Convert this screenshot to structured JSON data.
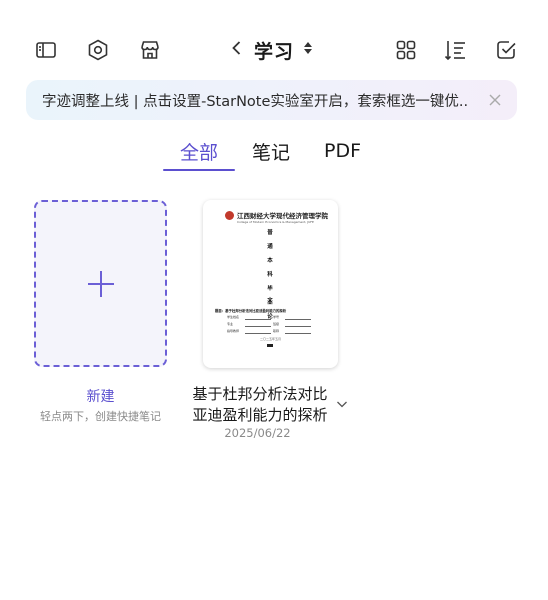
{
  "toolbar": {
    "title": "学习",
    "icons": [
      "sidebar-icon",
      "settings-hexagon-icon",
      "store-icon",
      "back-chevron-icon",
      "sort-updown-icon",
      "grid-view-icon",
      "sort-list-icon",
      "select-check-icon"
    ]
  },
  "banner": {
    "text": "字迹调整上线 | 点击设置-StarNote实验室开启，套索框选一键优.."
  },
  "tabs": [
    {
      "label": "全部",
      "active": true
    },
    {
      "label": "笔记",
      "active": false
    },
    {
      "label": "PDF",
      "active": false
    }
  ],
  "new_note": {
    "label": "新建",
    "hint": "轻点两下，创建快捷笔记"
  },
  "documents": [
    {
      "name_line1": "基于杜邦分析法对比",
      "name_line2": "亚迪盈利能力的探析",
      "date": "2025/06/22",
      "thumbnail": {
        "school": "江西财经大学现代经济管理学院",
        "school_en": "College of Modern Economics & Management, JUFE",
        "vertical_chars": [
          "普",
          "通",
          "本",
          "科",
          "毕",
          "业",
          "论",
          "文"
        ],
        "thesis_title": "题目：基于杜邦分析法对比亚迪盈利能力的探析",
        "fields": [
          {
            "k1": "学生姓名",
            "k2": "学号"
          },
          {
            "k1": "专业",
            "k2": "班级"
          },
          {
            "k1": "指导教师",
            "k2": "职称"
          }
        ],
        "date_text": "二〇二五年五月"
      }
    }
  ],
  "colors": {
    "accent": "#5b4fcf",
    "text": "#1a1a1a",
    "muted": "#8a8a8a"
  }
}
